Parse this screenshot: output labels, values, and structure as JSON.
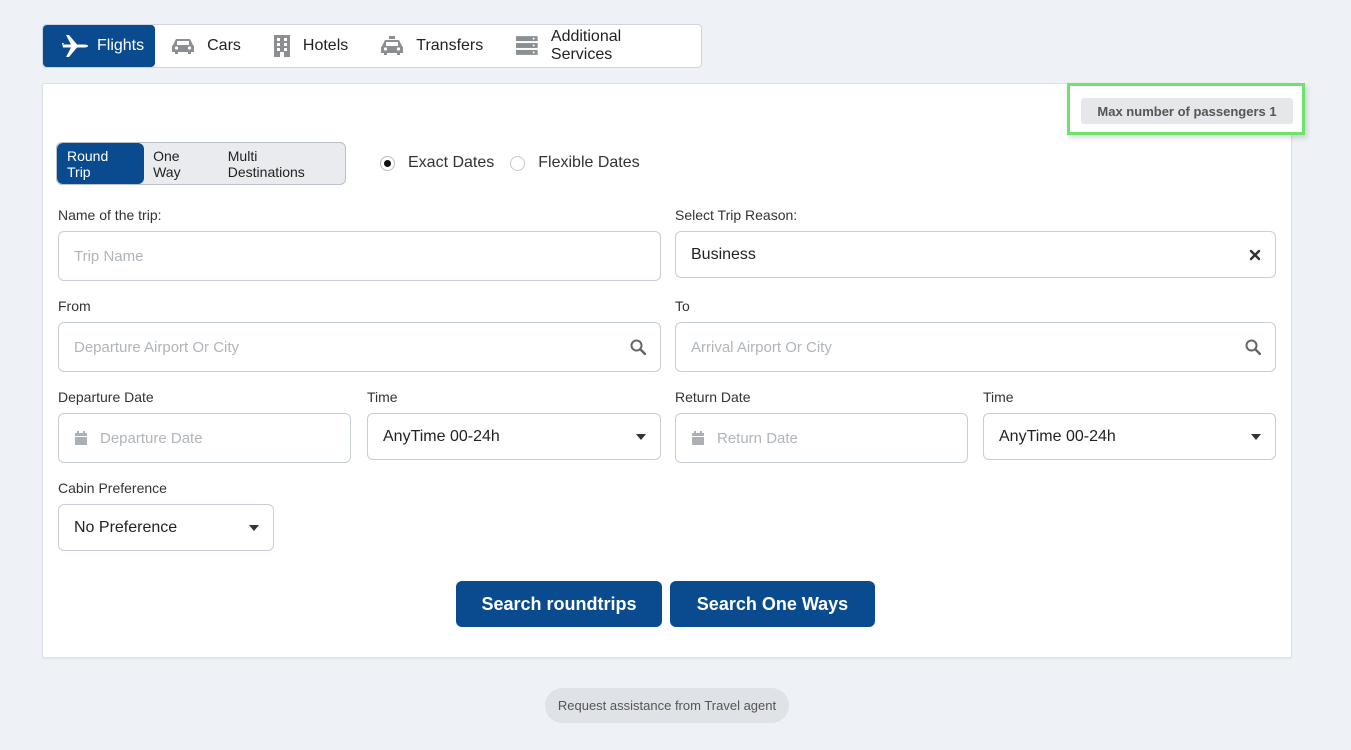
{
  "tabs": [
    {
      "label": "Flights",
      "icon": "plane-icon",
      "active": true
    },
    {
      "label": "Cars",
      "icon": "car-icon",
      "active": false
    },
    {
      "label": "Hotels",
      "icon": "building-icon",
      "active": false
    },
    {
      "label": "Transfers",
      "icon": "taxi-icon",
      "active": false
    },
    {
      "label": "Additional Services",
      "icon": "server-icon",
      "active": false
    }
  ],
  "passengers": {
    "label": "Max number of passengers 1"
  },
  "trip_type": {
    "options": [
      "Round Trip",
      "One Way",
      "Multi Destinations"
    ],
    "selected": "Round Trip"
  },
  "date_mode": {
    "exact": "Exact Dates",
    "flexible": "Flexible Dates",
    "selected": "Exact Dates"
  },
  "form": {
    "trip_name": {
      "label": "Name of the trip:",
      "placeholder": "Trip Name"
    },
    "trip_reason": {
      "label": "Select Trip Reason:",
      "value": "Business"
    },
    "from": {
      "label": "From",
      "placeholder": "Departure Airport Or City"
    },
    "to": {
      "label": "To",
      "placeholder": "Arrival Airport Or City"
    },
    "departure_date": {
      "label": "Departure Date",
      "placeholder": "Departure Date"
    },
    "departure_time": {
      "label": "Time",
      "value": "AnyTime 00-24h"
    },
    "return_date": {
      "label": "Return Date",
      "placeholder": "Return Date"
    },
    "return_time": {
      "label": "Time",
      "value": "AnyTime 00-24h"
    },
    "cabin": {
      "label": "Cabin Preference",
      "value": "No Preference"
    }
  },
  "buttons": {
    "search_roundtrips": "Search roundtrips",
    "search_one_ways": "Search One Ways"
  },
  "assist": {
    "label": "Request assistance from Travel agent"
  },
  "colors": {
    "primary": "#0a4a8f",
    "highlight": "#6ee36b",
    "background": "#eef2f6"
  }
}
